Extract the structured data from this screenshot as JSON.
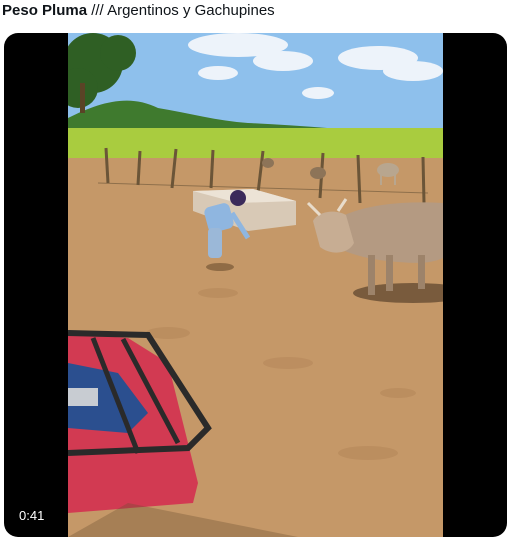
{
  "tweet": {
    "author": "Peso Pluma",
    "separator": "///",
    "text": "Argentinos y Gachupines"
  },
  "video": {
    "duration": "0:41",
    "scene": [
      "sky",
      "clouds",
      "trees",
      "field",
      "fence",
      "water-trough",
      "worker",
      "bull",
      "cattle",
      "dirt-ground",
      "atv-rack"
    ]
  }
}
